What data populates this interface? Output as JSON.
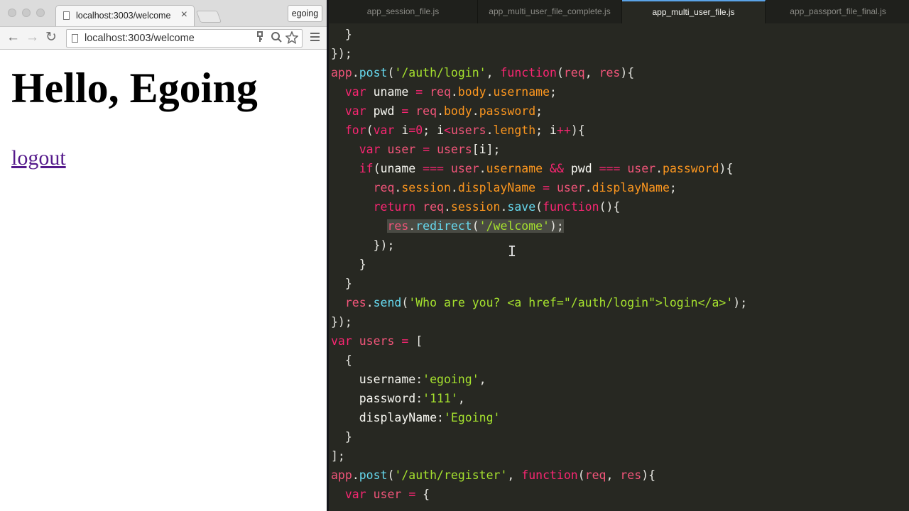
{
  "browser": {
    "tab_title": "localhost:3003/welcome",
    "tab_close": "×",
    "profile_name": "egoing",
    "url": "localhost:3003/welcome",
    "back_glyph": "←",
    "forward_glyph": "→",
    "reload_glyph": "↻",
    "page": {
      "heading": "Hello, Egoing",
      "link": "logout"
    }
  },
  "editor": {
    "tabs": [
      {
        "label": "app_session_file.js"
      },
      {
        "label": "app_multi_user_file_complete.js"
      },
      {
        "label": "app_multi_user_file.js",
        "active": true
      },
      {
        "label": "app_passport_file_final.js"
      }
    ],
    "code_lines": [
      "  }",
      "});",
      "app.post('/auth/login', function(req, res){",
      "  var uname = req.body.username;",
      "  var pwd = req.body.password;",
      "  for(var i=0; i<users.length; i++){",
      "    var user = users[i];",
      "    if(uname === user.username && pwd === user.password){",
      "      req.session.displayName = user.displayName;",
      "      return req.session.save(function(){",
      "        res.redirect('/welcome');",
      "      });",
      "    }",
      "  }",
      "  res.send('Who are you? <a href=\"/auth/login\">login</a>');",
      "});",
      "var users = [",
      "  {",
      "    username:'egoing',",
      "    password:'111',",
      "    displayName:'Egoing'",
      "  }",
      "];",
      "app.post('/auth/register', function(req, res){",
      "  var user = {"
    ]
  },
  "colors": {
    "editor_bg": "#272822",
    "keyword": "#f92672",
    "string": "#a6e22e",
    "variable": "#f2557a",
    "property": "#fd971f",
    "function": "#66d9ef",
    "link_visited": "#551a8b"
  }
}
